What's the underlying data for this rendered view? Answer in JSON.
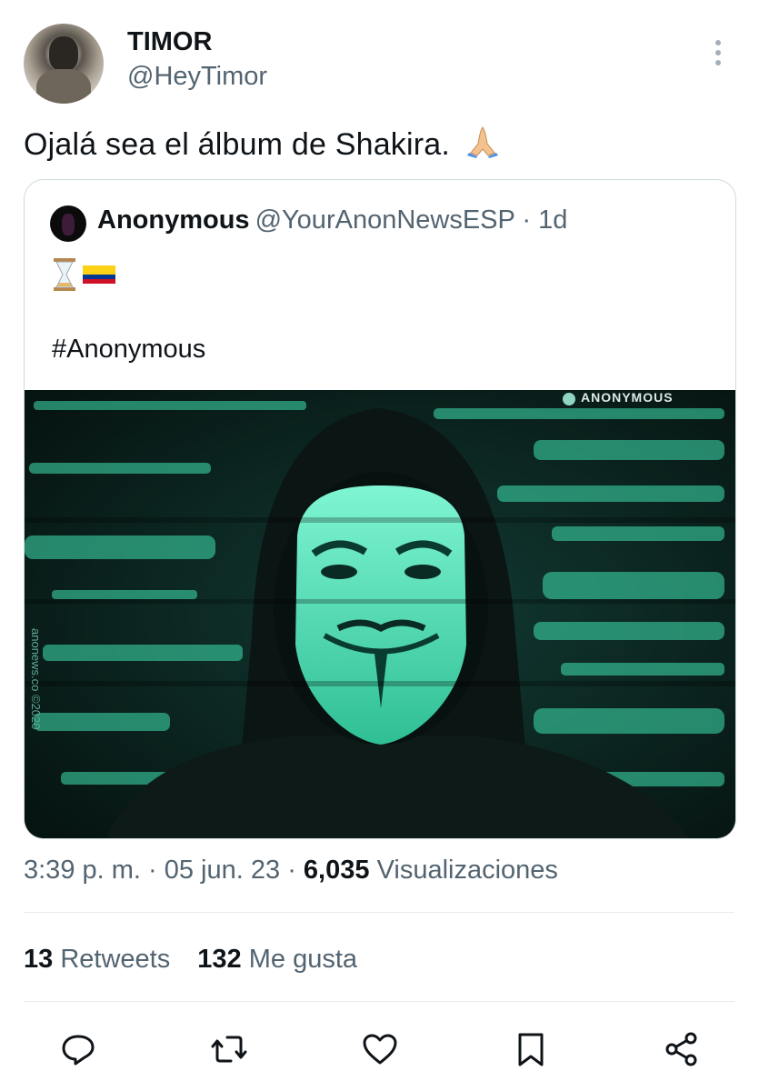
{
  "author": {
    "name": "TIMOR",
    "handle": "@HeyTimor"
  },
  "tweet": {
    "text": "Ojalá sea el álbum de Shakira."
  },
  "quoted": {
    "name": "Anonymous",
    "handle": "@YourAnonNewsESP",
    "age": "· 1d",
    "hashtag": "#Anonymous",
    "image_watermark": "ANONYMOUS",
    "image_side_text": "anonews.co ©2020"
  },
  "meta": {
    "time": "3:39 p. m.",
    "date": "· 05 jun. 23 ·",
    "views_count": "6,035",
    "views_label": "Visualizaciones"
  },
  "stats": {
    "retweets_count": "13",
    "retweets_label": "Retweets",
    "likes_count": "132",
    "likes_label": "Me gusta"
  },
  "actions": {
    "icons": [
      "reply-icon",
      "retweet-icon",
      "like-icon",
      "bookmark-icon",
      "share-icon"
    ]
  },
  "colors": {
    "secondary_text": "#536471",
    "primary_text": "#0f1419",
    "border": "#cfd9de",
    "matrix_green": "#3fe0b0"
  }
}
